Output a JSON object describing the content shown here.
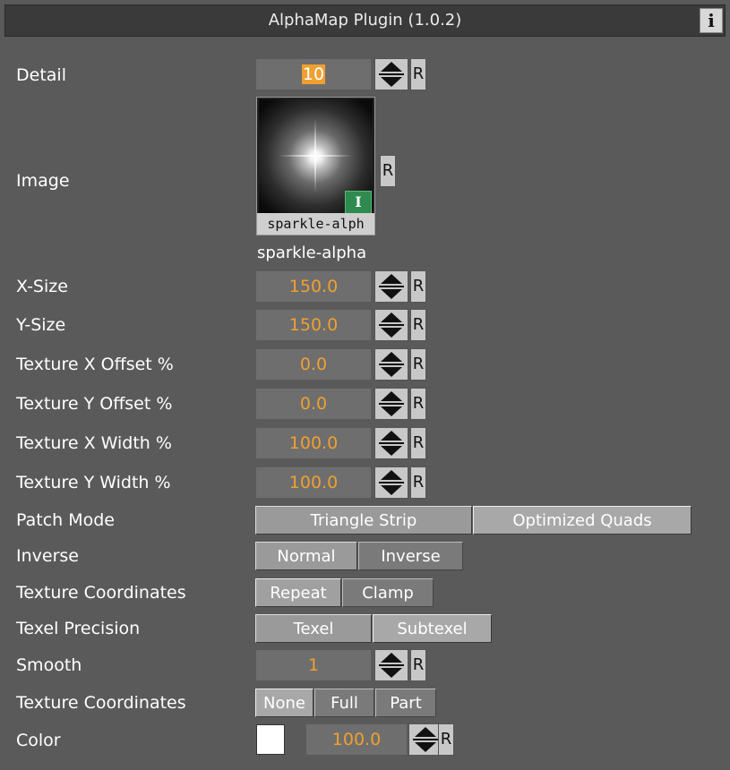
{
  "window": {
    "title": "AlphaMap Plugin (1.0.2)",
    "info_glyph": "i"
  },
  "reset_label": "R",
  "detail": {
    "label": "Detail",
    "value": "10"
  },
  "image": {
    "label": "Image",
    "thumb_caption": "sparkle-alph",
    "badge_glyph": "I",
    "name": "sparkle-alpha"
  },
  "x_size": {
    "label": "X-Size",
    "value": "150.0"
  },
  "y_size": {
    "label": "Y-Size",
    "value": "150.0"
  },
  "tex_x_offset": {
    "label": "Texture X Offset %",
    "value": "0.0"
  },
  "tex_y_offset": {
    "label": "Texture Y Offset %",
    "value": "0.0"
  },
  "tex_x_width": {
    "label": "Texture X Width %",
    "value": "100.0"
  },
  "tex_y_width": {
    "label": "Texture Y Width %",
    "value": "100.0"
  },
  "patch_mode": {
    "label": "Patch Mode",
    "options": [
      "Triangle Strip",
      "Optimized Quads"
    ],
    "selected": "Optimized Quads"
  },
  "inverse": {
    "label": "Inverse",
    "options": [
      "Normal",
      "Inverse"
    ],
    "selected": "Inverse"
  },
  "texture_coordinates_wrap": {
    "label": "Texture Coordinates",
    "options": [
      "Repeat",
      "Clamp"
    ],
    "selected": "Repeat"
  },
  "texel_precision": {
    "label": "Texel Precision",
    "options": [
      "Texel",
      "Subtexel"
    ],
    "selected": "Subtexel"
  },
  "smooth": {
    "label": "Smooth",
    "value": "1"
  },
  "texture_coordinates_mode": {
    "label": "Texture Coordinates",
    "options": [
      "None",
      "Full",
      "Part"
    ],
    "selected": "None"
  },
  "color": {
    "label": "Color",
    "swatch": "#ffffff",
    "value": "100.0"
  },
  "colors": {
    "background": "#5a5a5a",
    "value_text": "#f0a030",
    "titlebar": "#3a3a3a"
  }
}
